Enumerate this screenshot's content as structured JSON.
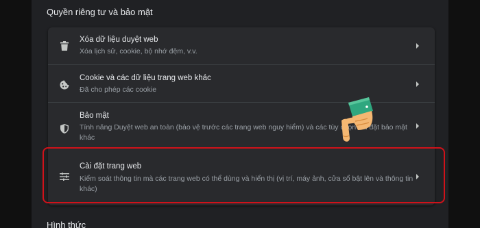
{
  "section_title": "Quyền riêng tư và bảo mật",
  "next_section_title": "Hình thức",
  "rows": [
    {
      "icon": "trash-icon",
      "title": "Xóa dữ liệu duyệt web",
      "subtitle": "Xóa lịch sử, cookie, bộ nhớ đệm, v.v."
    },
    {
      "icon": "cookie-icon",
      "title": "Cookie và các dữ liệu trang web khác",
      "subtitle": "Đã cho phép các cookie"
    },
    {
      "icon": "shield-icon",
      "title": "Bảo mật",
      "subtitle": "Tính năng Duyệt web an toàn (bảo vệ trước các trang web nguy hiểm) và các tùy chọn cài đặt bảo mật khác"
    },
    {
      "icon": "sliders-icon",
      "title": "Cài đặt trang web",
      "subtitle": "Kiểm soát thông tin mà các trang web có thể dùng và hiển thị (vị trí, máy ảnh, cửa sổ bật lên và thông tin khác)"
    }
  ],
  "colors": {
    "background": "#202124",
    "card": "#292a2d",
    "highlight": "#d1121a",
    "text_primary": "#e8eaed",
    "text_secondary": "#9aa0a6"
  }
}
